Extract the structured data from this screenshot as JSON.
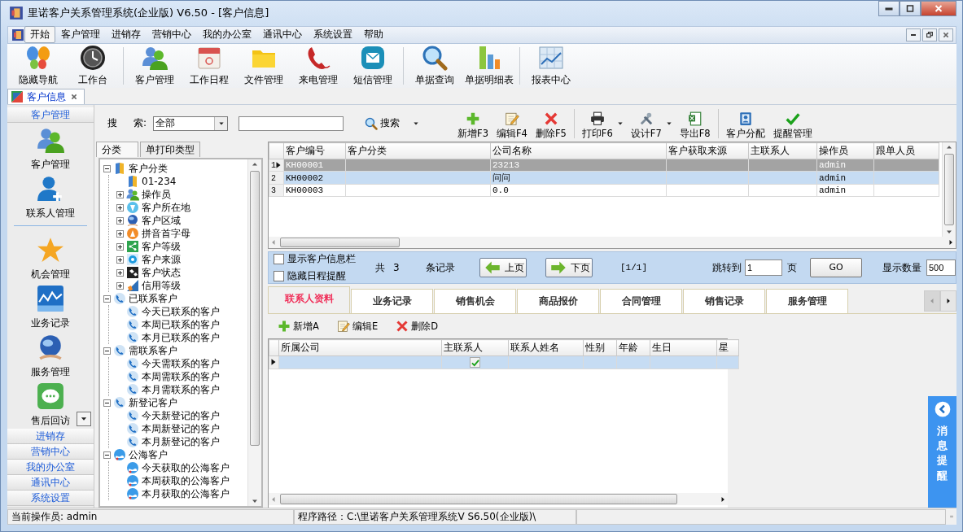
{
  "window": {
    "title": "里诺客户关系管理系统(企业版) V6.50 - [客户信息]"
  },
  "menu": [
    {
      "label": "开始",
      "selected": true
    },
    {
      "label": "客户管理",
      "selected": false
    },
    {
      "label": "进销存",
      "selected": false
    },
    {
      "label": "营销中心",
      "selected": false
    },
    {
      "label": "我的办公室",
      "selected": false
    },
    {
      "label": "通讯中心",
      "selected": false
    },
    {
      "label": "系统设置",
      "selected": false
    },
    {
      "label": "帮助",
      "selected": false
    }
  ],
  "toolbar": [
    {
      "kind": "button",
      "label": "隐藏导航"
    },
    {
      "kind": "button",
      "label": "工作台"
    },
    {
      "kind": "separator"
    },
    {
      "kind": "button",
      "label": "客户管理"
    },
    {
      "kind": "button",
      "label": "工作日程"
    },
    {
      "kind": "button",
      "label": "文件管理"
    },
    {
      "kind": "button",
      "label": "来电管理"
    },
    {
      "kind": "button",
      "label": "短信管理"
    },
    {
      "kind": "separator"
    },
    {
      "kind": "button",
      "label": "单据查询"
    },
    {
      "kind": "button",
      "label": "单据明细表"
    },
    {
      "kind": "separator"
    },
    {
      "kind": "button",
      "label": "报表中心"
    }
  ],
  "doc_tabs": [
    {
      "label": "客户信息",
      "selected": true
    }
  ],
  "nav": {
    "header": "客户管理",
    "items": [
      {
        "kind": "button",
        "label": "客户管理"
      },
      {
        "kind": "button",
        "label": "联系人管理"
      },
      {
        "kind": "separator"
      },
      {
        "kind": "button",
        "label": "机会管理"
      },
      {
        "kind": "button",
        "label": "业务记录"
      },
      {
        "kind": "button",
        "label": "服务管理"
      },
      {
        "kind": "button",
        "label": "售后回访"
      }
    ],
    "sections": [
      "进销存",
      "营销中心",
      "我的办公室",
      "通讯中心",
      "系统设置"
    ]
  },
  "search": {
    "label_1": "搜",
    "label_2": "索:",
    "scope": "全部",
    "button": "搜索"
  },
  "actions": [
    {
      "kind": "button",
      "label": "新增F3"
    },
    {
      "kind": "button",
      "label": "编辑F4"
    },
    {
      "kind": "button",
      "label": "删除F5"
    },
    {
      "kind": "separator"
    },
    {
      "kind": "split",
      "label": "打印F6"
    },
    {
      "kind": "split",
      "label": "设计F7"
    },
    {
      "kind": "button",
      "label": "导出F8"
    },
    {
      "kind": "separator"
    },
    {
      "kind": "button",
      "label": "客户分配"
    },
    {
      "kind": "button",
      "label": "提醒管理"
    }
  ],
  "tree_tabs": [
    {
      "label": "分类",
      "selected": true
    },
    {
      "label": "单打印类型",
      "selected": false
    }
  ],
  "tree": [
    {
      "label": "客户分类",
      "expanded": true,
      "children": [
        {
          "label": "01-234"
        },
        {
          "label": "操作员",
          "expanded": false
        },
        {
          "label": "客户所在地",
          "expanded": false
        },
        {
          "label": "客户区域",
          "expanded": false
        },
        {
          "label": "拼音首字母",
          "expanded": false
        },
        {
          "label": "客户等级",
          "expanded": false
        },
        {
          "label": "客户来源",
          "expanded": false
        },
        {
          "label": "客户状态",
          "expanded": false
        },
        {
          "label": "信用等级",
          "expanded": false
        }
      ]
    },
    {
      "label": "已联系客户",
      "expanded": true,
      "children": [
        {
          "label": "今天已联系的客户"
        },
        {
          "label": "本周已联系的客户"
        },
        {
          "label": "本月已联系的客户"
        }
      ]
    },
    {
      "label": "需联系客户",
      "expanded": true,
      "children": [
        {
          "label": "今天需联系的客户"
        },
        {
          "label": "本周需联系的客户"
        },
        {
          "label": "本月需联系的客户"
        }
      ]
    },
    {
      "label": "新登记客户",
      "expanded": true,
      "children": [
        {
          "label": "今天新登记的客户"
        },
        {
          "label": "本周新登记的客户"
        },
        {
          "label": "本月新登记的客户"
        }
      ]
    },
    {
      "label": "公海客户",
      "expanded": true,
      "children": [
        {
          "label": "今天获取的公海客户"
        },
        {
          "label": "本周获取的公海客户"
        },
        {
          "label": "本月获取的公海客户"
        }
      ]
    }
  ],
  "grid": {
    "columns": [
      "客户编号",
      "客户分类",
      "公司名称",
      "客户获取来源",
      "主联系人",
      "操作员",
      "跟单人员"
    ],
    "rows": [
      {
        "index": "1",
        "current": true,
        "selected": false,
        "cells": [
          "KH00001",
          null,
          "23213",
          null,
          null,
          "admin",
          null
        ]
      },
      {
        "index": "2",
        "current": false,
        "selected": true,
        "cells": [
          "KH00002",
          null,
          "问问",
          null,
          null,
          "admin",
          null
        ]
      },
      {
        "index": "3",
        "current": false,
        "selected": false,
        "cells": [
          "KH00003",
          null,
          "0.0",
          null,
          null,
          "admin",
          null
        ]
      }
    ]
  },
  "pager": {
    "options": [
      {
        "label": "显示客户信息栏",
        "checked": false
      },
      {
        "label": "隐藏日程提醒",
        "checked": false
      }
    ],
    "total_label": "共",
    "total": "3",
    "records_label": "条记录",
    "prev": "上页",
    "next": "下页",
    "page": "[1/1]",
    "jump_label": "跳转到",
    "jump_value": "1",
    "page_label": "页",
    "go": "GO",
    "size_label": "显示数量",
    "size_value": "500"
  },
  "detail_tabs": [
    {
      "label": "联系人资料",
      "selected": true
    },
    {
      "label": "业务记录",
      "selected": false
    },
    {
      "label": "销售机会",
      "selected": false
    },
    {
      "label": "商品报价",
      "selected": false
    },
    {
      "label": "合同管理",
      "selected": false
    },
    {
      "label": "销售记录",
      "selected": false
    },
    {
      "label": "服务管理",
      "selected": false
    }
  ],
  "detail_actions": [
    "新增A",
    "编辑E",
    "删除D"
  ],
  "contacts": {
    "columns": [
      "所属公司",
      "主联系人",
      "联系人姓名",
      "性别",
      "年龄",
      "生日",
      "星"
    ],
    "rows": [
      {
        "current": true,
        "primary_contact": true
      }
    ]
  },
  "reminder": {
    "label": "消息提醒"
  },
  "status_bar": {
    "operator": "当前操作员: admin",
    "path": "程序路径：C:\\里诺客户关系管理系统V S6.50(企业版)\\"
  }
}
